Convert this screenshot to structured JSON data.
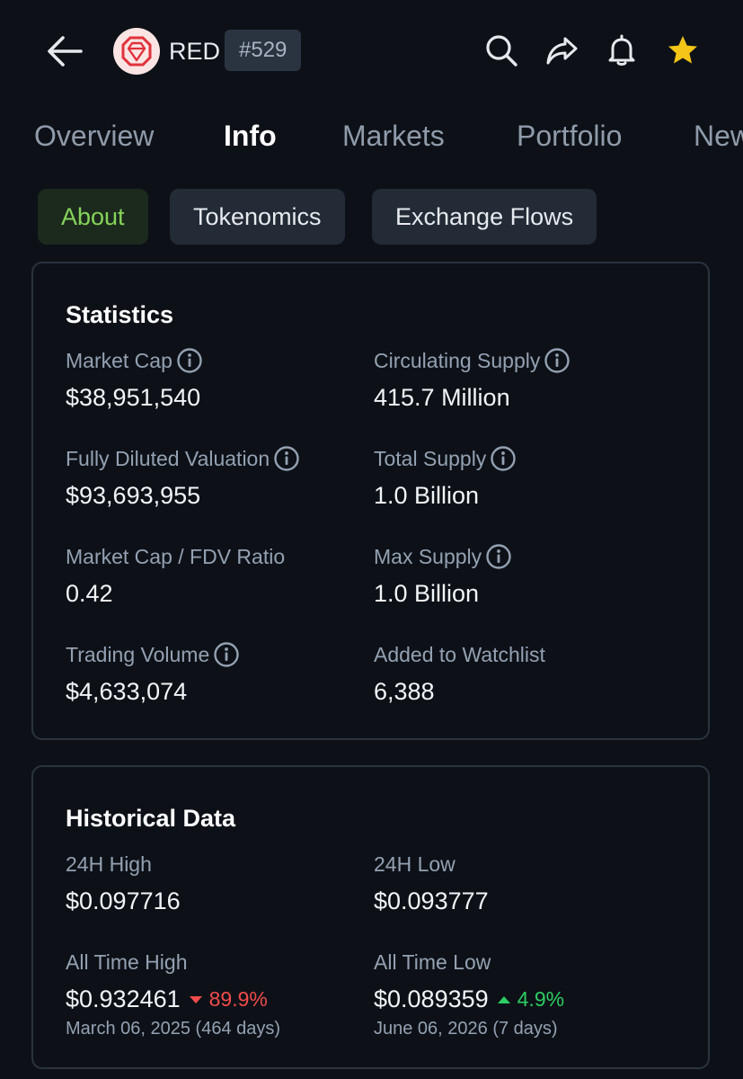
{
  "header": {
    "coin_name": "RED",
    "rank": "#529",
    "star_color": "#f5c518",
    "brand_color": "#e0323c"
  },
  "tabs": [
    {
      "label": "Overview",
      "active": false
    },
    {
      "label": "Info",
      "active": true
    },
    {
      "label": "Markets",
      "active": false
    },
    {
      "label": "Portfolio",
      "active": false
    },
    {
      "label": "News",
      "active": false
    }
  ],
  "subtabs": [
    {
      "label": "About",
      "active": true
    },
    {
      "label": "Tokenomics",
      "active": false
    },
    {
      "label": "Exchange Flows",
      "active": false
    }
  ],
  "statistics": {
    "title": "Statistics",
    "items": [
      {
        "label": "Market Cap",
        "value": "$38,951,540",
        "info": true
      },
      {
        "label": "Circulating Supply",
        "value": "415.7 Million",
        "info": true
      },
      {
        "label": "Fully Diluted Valuation",
        "value": "$93,693,955",
        "info": true
      },
      {
        "label": "Total Supply",
        "value": "1.0 Billion",
        "info": true
      },
      {
        "label": "Market Cap / FDV Ratio",
        "value": "0.42",
        "info": false
      },
      {
        "label": "Max Supply",
        "value": "1.0 Billion",
        "info": true
      },
      {
        "label": "Trading Volume",
        "value": "$4,633,074",
        "info": true
      },
      {
        "label": "Added to Watchlist",
        "value": "6,388",
        "info": false
      }
    ]
  },
  "historical": {
    "title": "Historical Data",
    "high_24h": {
      "label": "24H High",
      "value": "$0.097716"
    },
    "low_24h": {
      "label": "24H Low",
      "value": "$0.093777"
    },
    "ath": {
      "label": "All Time High",
      "value": "$0.932461",
      "change": "89.9%",
      "date": "March 06, 2025 (464 days)"
    },
    "atl": {
      "label": "All Time Low",
      "value": "$0.089359",
      "change": "4.9%",
      "date": "June 06, 2026 (7 days)"
    }
  }
}
